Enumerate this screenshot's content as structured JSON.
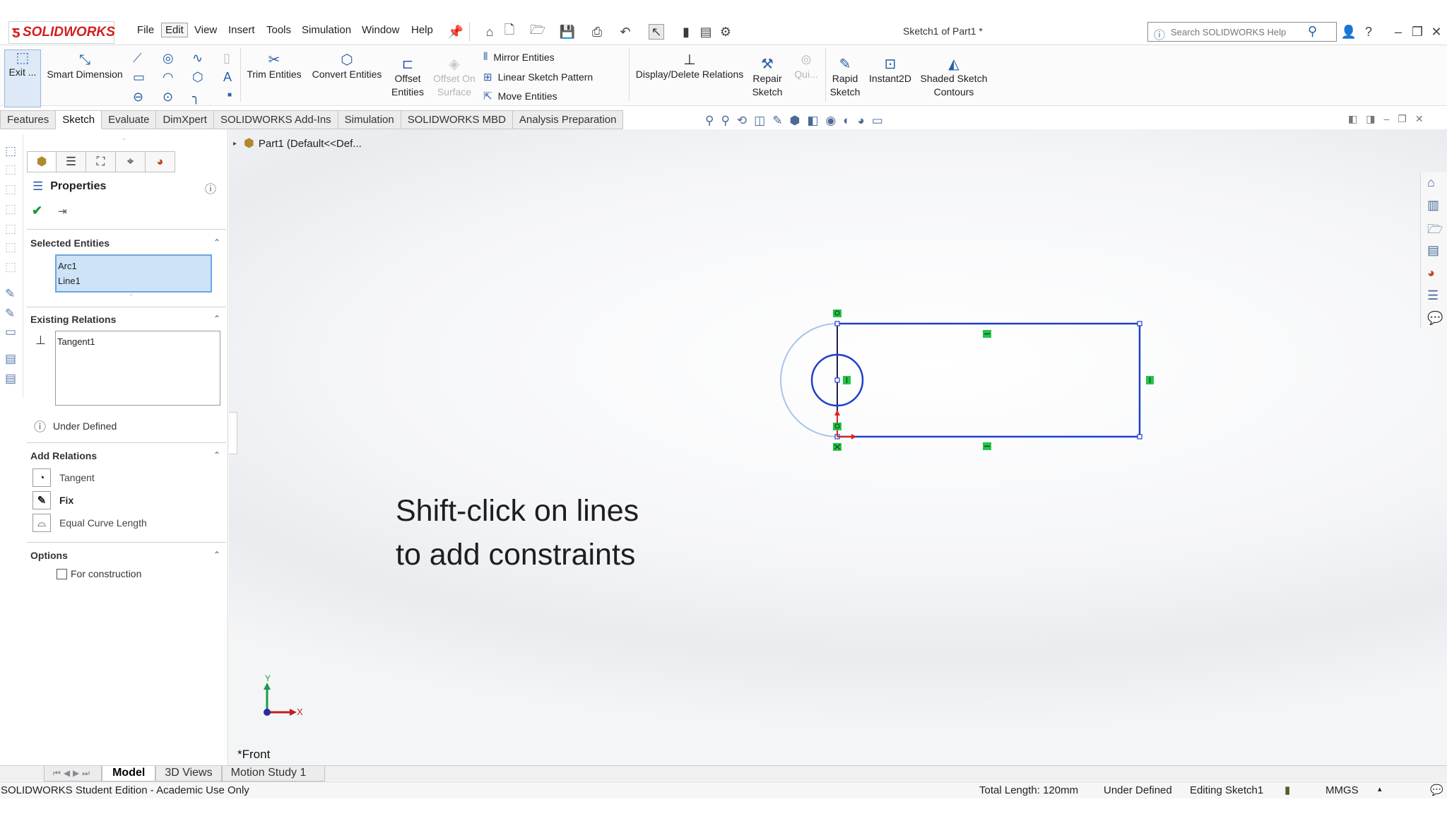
{
  "app": {
    "brand": "SOLIDWORKS",
    "document_title": "Sketch1 of Part1 *"
  },
  "menu": [
    "File",
    "Edit",
    "View",
    "Insert",
    "Tools",
    "Simulation",
    "Window",
    "Help"
  ],
  "search": {
    "placeholder": "Search SOLIDWORKS Help"
  },
  "ribbon": {
    "exit": "Exit ...",
    "smart_dimension": "Smart Dimension",
    "trim_entities": "Trim Entities",
    "convert_entities": "Convert Entities",
    "offset_entities_1": "Offset",
    "offset_entities_2": "Entities",
    "offset_surface_1": "Offset On",
    "offset_surface_2": "Surface",
    "mirror_entities": "Mirror Entities",
    "linear_sketch_pattern": "Linear Sketch Pattern",
    "move_entities": "Move Entities",
    "display_delete_relations": "Display/Delete Relations",
    "repair_sketch_1": "Repair",
    "repair_sketch_2": "Sketch",
    "quick_snaps": "Qui...",
    "rapid_sketch_1": "Rapid",
    "rapid_sketch_2": "Sketch",
    "instant2d": "Instant2D",
    "shaded_contours_1": "Shaded Sketch",
    "shaded_contours_2": "Contours"
  },
  "tabs": [
    "Features",
    "Sketch",
    "Evaluate",
    "DimXpert",
    "SOLIDWORKS Add-Ins",
    "Simulation",
    "SOLIDWORKS MBD",
    "Analysis Preparation"
  ],
  "property_manager": {
    "title": "Properties",
    "selected_entities": {
      "header": "Selected Entities",
      "items": [
        "Arc1",
        "Line1"
      ]
    },
    "existing_relations": {
      "header": "Existing Relations",
      "items": [
        "Tangent1"
      ]
    },
    "status": "Under Defined",
    "add_relations": {
      "header": "Add Relations",
      "items": [
        "Tangent",
        "Fix",
        "Equal Curve Length"
      ]
    },
    "options": {
      "header": "Options",
      "for_construction": "For construction"
    }
  },
  "feature_tree": {
    "item": "Part1  (Default<<Def..."
  },
  "graphics": {
    "caption_line1": "Shift-click on lines",
    "caption_line2": "to add constraints",
    "view_label": "*Front",
    "triad_x": "X",
    "triad_y": "Y"
  },
  "bottom_tabs": [
    "Model",
    "3D Views",
    "Motion Study 1"
  ],
  "status_bar": {
    "edition": "SOLIDWORKS Student Edition - Academic Use Only",
    "total_length": "Total Length: 120mm",
    "definition": "Under Defined",
    "editing": "Editing Sketch1",
    "units": "MMGS"
  },
  "colors": {
    "sketch_blue": "#1f3fcf",
    "relation_green": "#27c24a",
    "brand_red": "#d21f1f"
  }
}
